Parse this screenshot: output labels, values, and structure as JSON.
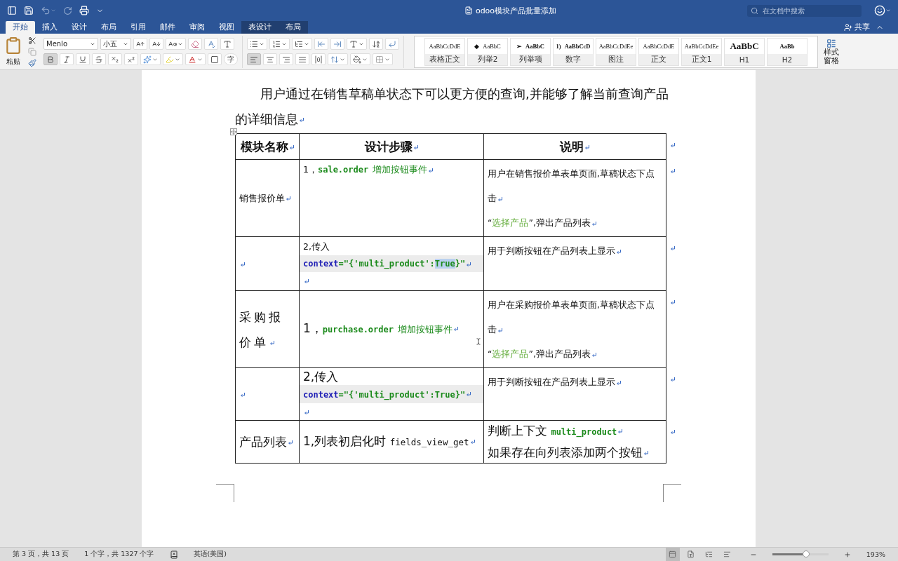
{
  "title_bar": {
    "title": "odoo模块产品批量添加",
    "search_placeholder": "在文档中搜索"
  },
  "ribbon_tabs": [
    {
      "label": "开始",
      "selected": true,
      "kind": "main"
    },
    {
      "label": "插入",
      "selected": false,
      "kind": "main"
    },
    {
      "label": "设计",
      "selected": false,
      "kind": "main"
    },
    {
      "label": "布局",
      "selected": false,
      "kind": "main"
    },
    {
      "label": "引用",
      "selected": false,
      "kind": "main"
    },
    {
      "label": "邮件",
      "selected": false,
      "kind": "main"
    },
    {
      "label": "审阅",
      "selected": false,
      "kind": "main"
    },
    {
      "label": "视图",
      "selected": false,
      "kind": "main"
    },
    {
      "label": "表设计",
      "selected": false,
      "kind": "table"
    },
    {
      "label": "布局",
      "selected": false,
      "kind": "table"
    }
  ],
  "share_label": "共享",
  "ribbon": {
    "paste_label": "粘贴",
    "font_name": "Menlo",
    "font_size": "小五",
    "enclosed_char": "字",
    "format_buttons": [
      {
        "kind": "bold",
        "on": true
      },
      {
        "kind": "italic",
        "on": false
      },
      {
        "kind": "underline",
        "on": false
      },
      {
        "kind": "strikethrough",
        "on": false
      },
      {
        "kind": "subscript",
        "on": false
      },
      {
        "kind": "superscript",
        "on": false
      }
    ],
    "align_buttons": [
      {
        "kind": "left",
        "selected": true
      },
      {
        "kind": "center",
        "selected": false
      },
      {
        "kind": "right",
        "selected": false
      },
      {
        "kind": "justify",
        "selected": false
      },
      {
        "kind": "distributed",
        "selected": false
      }
    ],
    "styles": [
      {
        "preview": "AaBbCcDdE",
        "label": "表格正文",
        "kind": "plain"
      },
      {
        "marker": "◆",
        "preview": "AaBbC",
        "label": "列举2",
        "kind": "plain"
      },
      {
        "marker": "➢",
        "preview": "AaBbC",
        "label": "列举项",
        "kind": "bold"
      },
      {
        "marker": "1)",
        "preview": "AaBbCcD",
        "label": "数字",
        "kind": "bold"
      },
      {
        "preview": "AaBbCcDdEe",
        "label": "图注",
        "kind": "plain"
      },
      {
        "preview": "AaBbCcDdE",
        "label": "正文",
        "kind": "plain"
      },
      {
        "preview": "AaBbCcDdEe",
        "label": "正文1",
        "kind": "plain"
      },
      {
        "preview": "AaBbC",
        "label": "H1",
        "kind": "heading"
      },
      {
        "preview": "AaBb",
        "label": "H2",
        "kind": "bold"
      }
    ],
    "style_pane_label": "样式窗格"
  },
  "document": {
    "intro": "用户通过在销售草稿单状态下可以更方便的查询,并能够了解当前查询产品的详细信息",
    "table": {
      "rows": [
        {
          "end_mark": true,
          "cells": [
            {
              "kind": "header",
              "lines": [
                {
                  "segments": [
                    {
                      "text": "模块名称",
                      "kind": "text"
                    }
                  ],
                  "mark": true
                }
              ]
            },
            {
              "kind": "header",
              "lines": [
                {
                  "segments": [
                    {
                      "text": "设计步骤",
                      "kind": "text"
                    }
                  ],
                  "mark": true
                }
              ]
            },
            {
              "kind": "header",
              "lines": [
                {
                  "segments": [
                    {
                      "text": "说明",
                      "kind": "text"
                    }
                  ],
                  "mark": true
                }
              ]
            }
          ]
        },
        {
          "end_mark": true,
          "cells": [
            {
              "kind": "small",
              "lines": [
                {
                  "segments": [
                    {
                      "text": "销售报价单",
                      "kind": "text"
                    }
                  ],
                  "mark": true
                }
              ]
            },
            {
              "kind": "small",
              "lines": [
                {
                  "segments": [
                    {
                      "text": "1，",
                      "kind": "text"
                    },
                    {
                      "text": "sale.order",
                      "kind": "code"
                    },
                    {
                      "text": "增加按钮事件",
                      "kind": "green_text"
                    }
                  ],
                  "mark": true
                }
              ]
            },
            {
              "kind": "small",
              "lines": [
                {
                  "segments": [
                    {
                      "text": "用户在销售报价单表单页面,草稿状态下点击",
                      "kind": "text"
                    }
                  ],
                  "mark": true
                },
                {
                  "segments": [
                    {
                      "text": "“",
                      "kind": "text"
                    },
                    {
                      "text": "选择产品",
                      "kind": "link"
                    },
                    {
                      "text": "”,弹出产品列表",
                      "kind": "text"
                    }
                  ],
                  "mark": true
                }
              ]
            }
          ]
        },
        {
          "end_mark": true,
          "cells": [
            {
              "kind": "small",
              "lines": [
                {
                  "mark": true
                }
              ]
            },
            {
              "kind": "small",
              "lines": [
                {
                  "segments": [
                    {
                      "text": "2,传入",
                      "kind": "text"
                    }
                  ]
                },
                {
                  "shaded": true,
                  "segments": [
                    {
                      "text": "context",
                      "kind": "keyword"
                    },
                    {
                      "text": "=\"{'multi_product':",
                      "kind": "code"
                    },
                    {
                      "text": "True",
                      "kind": "code",
                      "highlighted": true
                    },
                    {
                      "text": "}\"",
                      "kind": "code"
                    }
                  ],
                  "mark": true
                },
                {
                  "mark": true
                }
              ]
            },
            {
              "kind": "small",
              "lines": [
                {
                  "segments": [
                    {
                      "text": "用于判断按钮在产品列表上显示",
                      "kind": "text"
                    }
                  ],
                  "mark": true
                }
              ]
            }
          ]
        },
        {
          "end_mark": true,
          "cells": [
            {
              "kind": "large",
              "lines": [
                {
                  "segments": [
                    {
                      "text": "采购报价单",
                      "kind": "text"
                    }
                  ],
                  "mark": true
                }
              ]
            },
            {
              "kind": "large",
              "lines": [
                {
                  "segments": [
                    {
                      "text": "1，",
                      "kind": "text"
                    },
                    {
                      "text": "purchase.order",
                      "kind": "code"
                    },
                    {
                      "text": "增加按钮事件",
                      "kind": "green_text"
                    }
                  ],
                  "mark": true
                }
              ]
            },
            {
              "kind": "small",
              "lines": [
                {
                  "segments": [
                    {
                      "text": "用户在采购报价单表单页面,草稿状态下点击",
                      "kind": "text"
                    }
                  ],
                  "mark": true
                },
                {
                  "segments": [
                    {
                      "text": "“",
                      "kind": "text"
                    },
                    {
                      "text": "选择产品",
                      "kind": "link"
                    },
                    {
                      "text": "”,弹出产品列表",
                      "kind": "text"
                    }
                  ],
                  "mark": true
                }
              ]
            }
          ]
        },
        {
          "end_mark": true,
          "cells": [
            {
              "kind": "small",
              "lines": [
                {
                  "mark": true
                }
              ]
            },
            {
              "kind": "large",
              "lines": [
                {
                  "segments": [
                    {
                      "text": "2,传入",
                      "kind": "text"
                    }
                  ]
                },
                {
                  "shaded": true,
                  "segments": [
                    {
                      "text": "context",
                      "kind": "keyword"
                    },
                    {
                      "text": "=\"{'multi_product':True}\"",
                      "kind": "code"
                    }
                  ],
                  "mark": true
                },
                {
                  "mark": true
                }
              ]
            },
            {
              "kind": "small",
              "lines": [
                {
                  "segments": [
                    {
                      "text": "用于判断按钮在产品列表上显示",
                      "kind": "text"
                    }
                  ],
                  "mark": true
                }
              ]
            }
          ]
        },
        {
          "end_mark": true,
          "cells": [
            {
              "kind": "large",
              "lines": [
                {
                  "segments": [
                    {
                      "text": "产品列表",
                      "kind": "text"
                    }
                  ],
                  "mark": true
                }
              ]
            },
            {
              "kind": "large",
              "lines": [
                {
                  "segments": [
                    {
                      "text": "1,列表初启化时 ",
                      "kind": "text"
                    },
                    {
                      "text": "fields_view_get",
                      "kind": "mono"
                    }
                  ],
                  "mark": true
                }
              ]
            },
            {
              "kind": "large",
              "lines": [
                {
                  "segments": [
                    {
                      "text": "判断上下文 ",
                      "kind": "text"
                    },
                    {
                      "text": "multi_product",
                      "kind": "code"
                    }
                  ],
                  "mark": true
                },
                {
                  "segments": [
                    {
                      "text": "如果存在向列表添加两个按钮",
                      "kind": "text"
                    }
                  ],
                  "mark": true
                }
              ]
            }
          ]
        }
      ]
    }
  },
  "status_bar": {
    "page_info": "第 3 页，共 13 页",
    "word_count": "1 个字，共 1327 个字",
    "language": "英语(美国)",
    "view_buttons": [
      {
        "kind": "print",
        "selected": true
      },
      {
        "kind": "web",
        "selected": false
      },
      {
        "kind": "outline",
        "selected": false
      },
      {
        "kind": "draft",
        "selected": false
      }
    ],
    "zoom_slider": {
      "level": 0.6
    },
    "zoom": "193%"
  }
}
